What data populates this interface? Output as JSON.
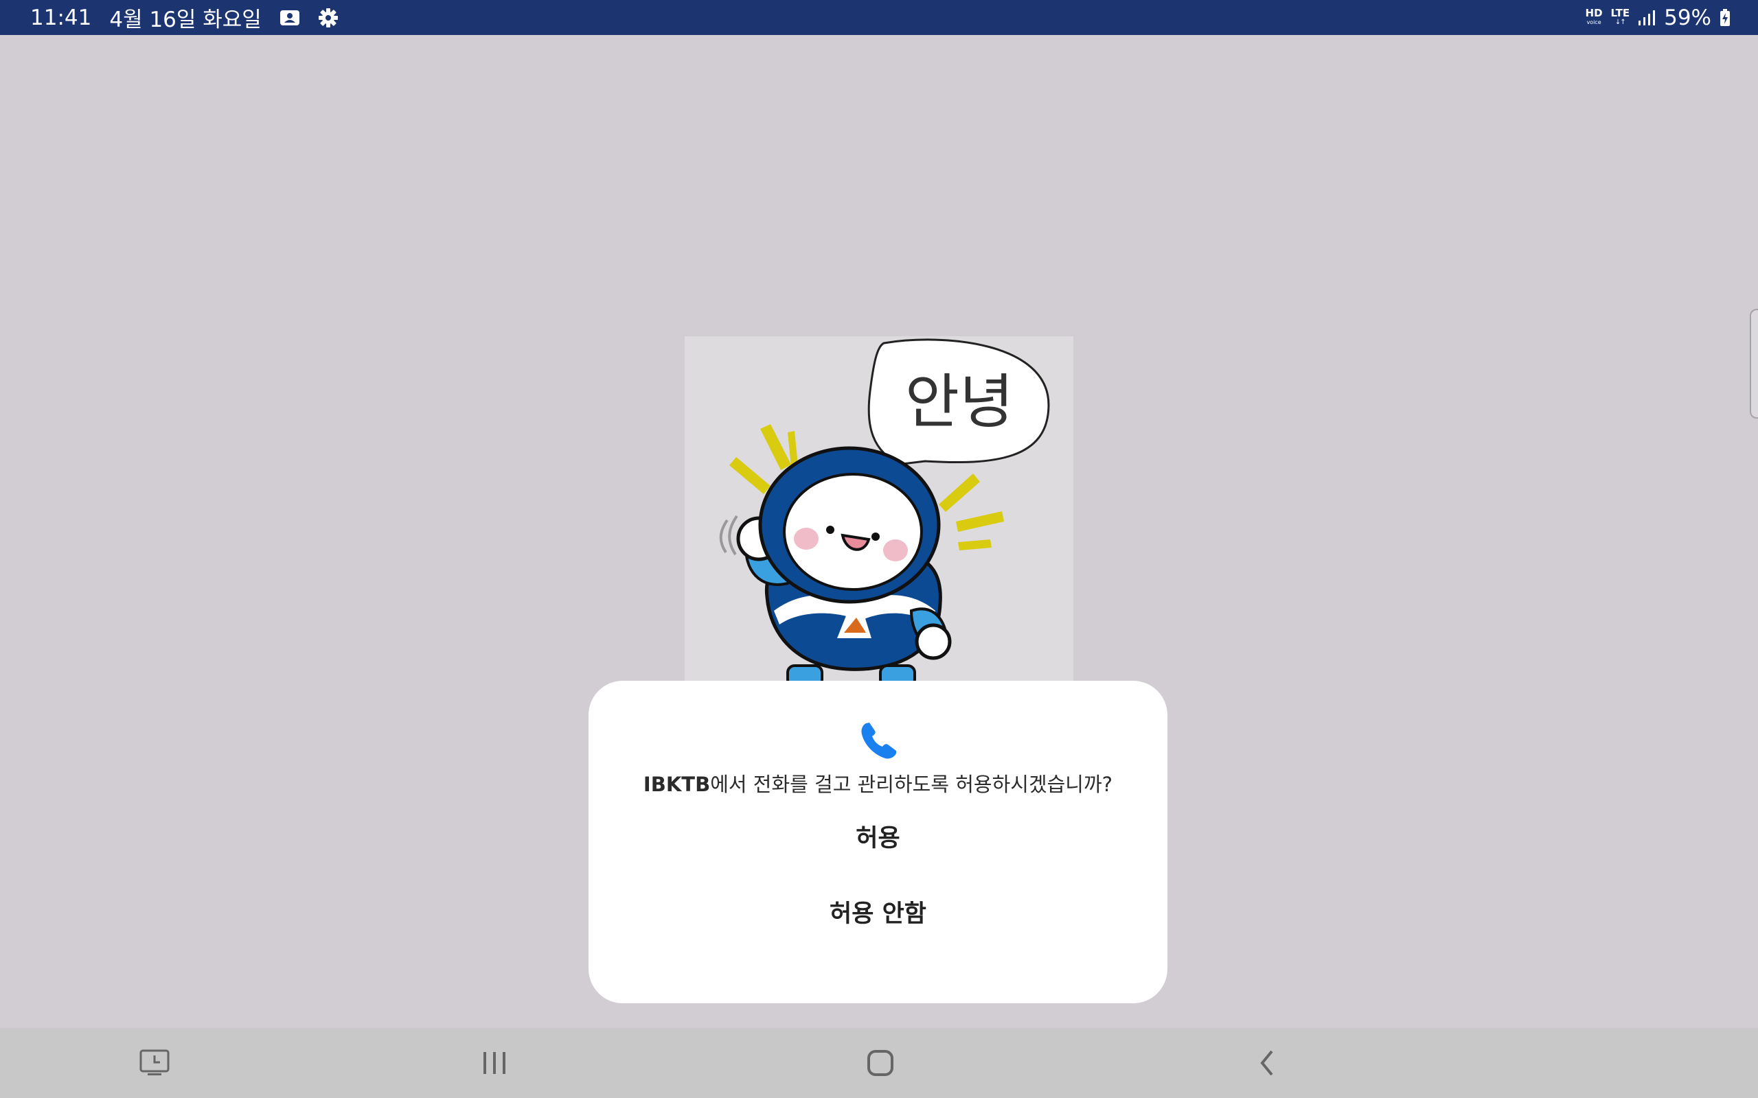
{
  "status_bar": {
    "time": "11:41",
    "date": "4월 16일 화요일",
    "hd_label": "HD",
    "hd_sub": "voice",
    "lte_label": "LTE",
    "lte_sub": "↓↑",
    "battery": "59%",
    "icons": [
      "screenshot-notification-icon",
      "settings-gear-icon",
      "hd-voice-icon",
      "lte-icon",
      "signal-icon",
      "battery-charging-icon"
    ]
  },
  "illustration": {
    "speech_text": "안녕"
  },
  "dialog": {
    "app_name": "IBKTB",
    "message_rest": "에서 전화를 걸고 관리하도록 허용하시겠습니까?",
    "allow_label": "허용",
    "deny_label": "허용 안함",
    "icon": "phone-icon",
    "accent_color": "#1a80f0"
  },
  "nav_bar": {
    "buttons": [
      "recent-apps-clock-icon",
      "recents-icon",
      "home-icon",
      "back-icon"
    ]
  },
  "colors": {
    "status_bar": "#1c3570",
    "background": "#d1cdd3",
    "nav_bar": "#c8c8c8"
  }
}
